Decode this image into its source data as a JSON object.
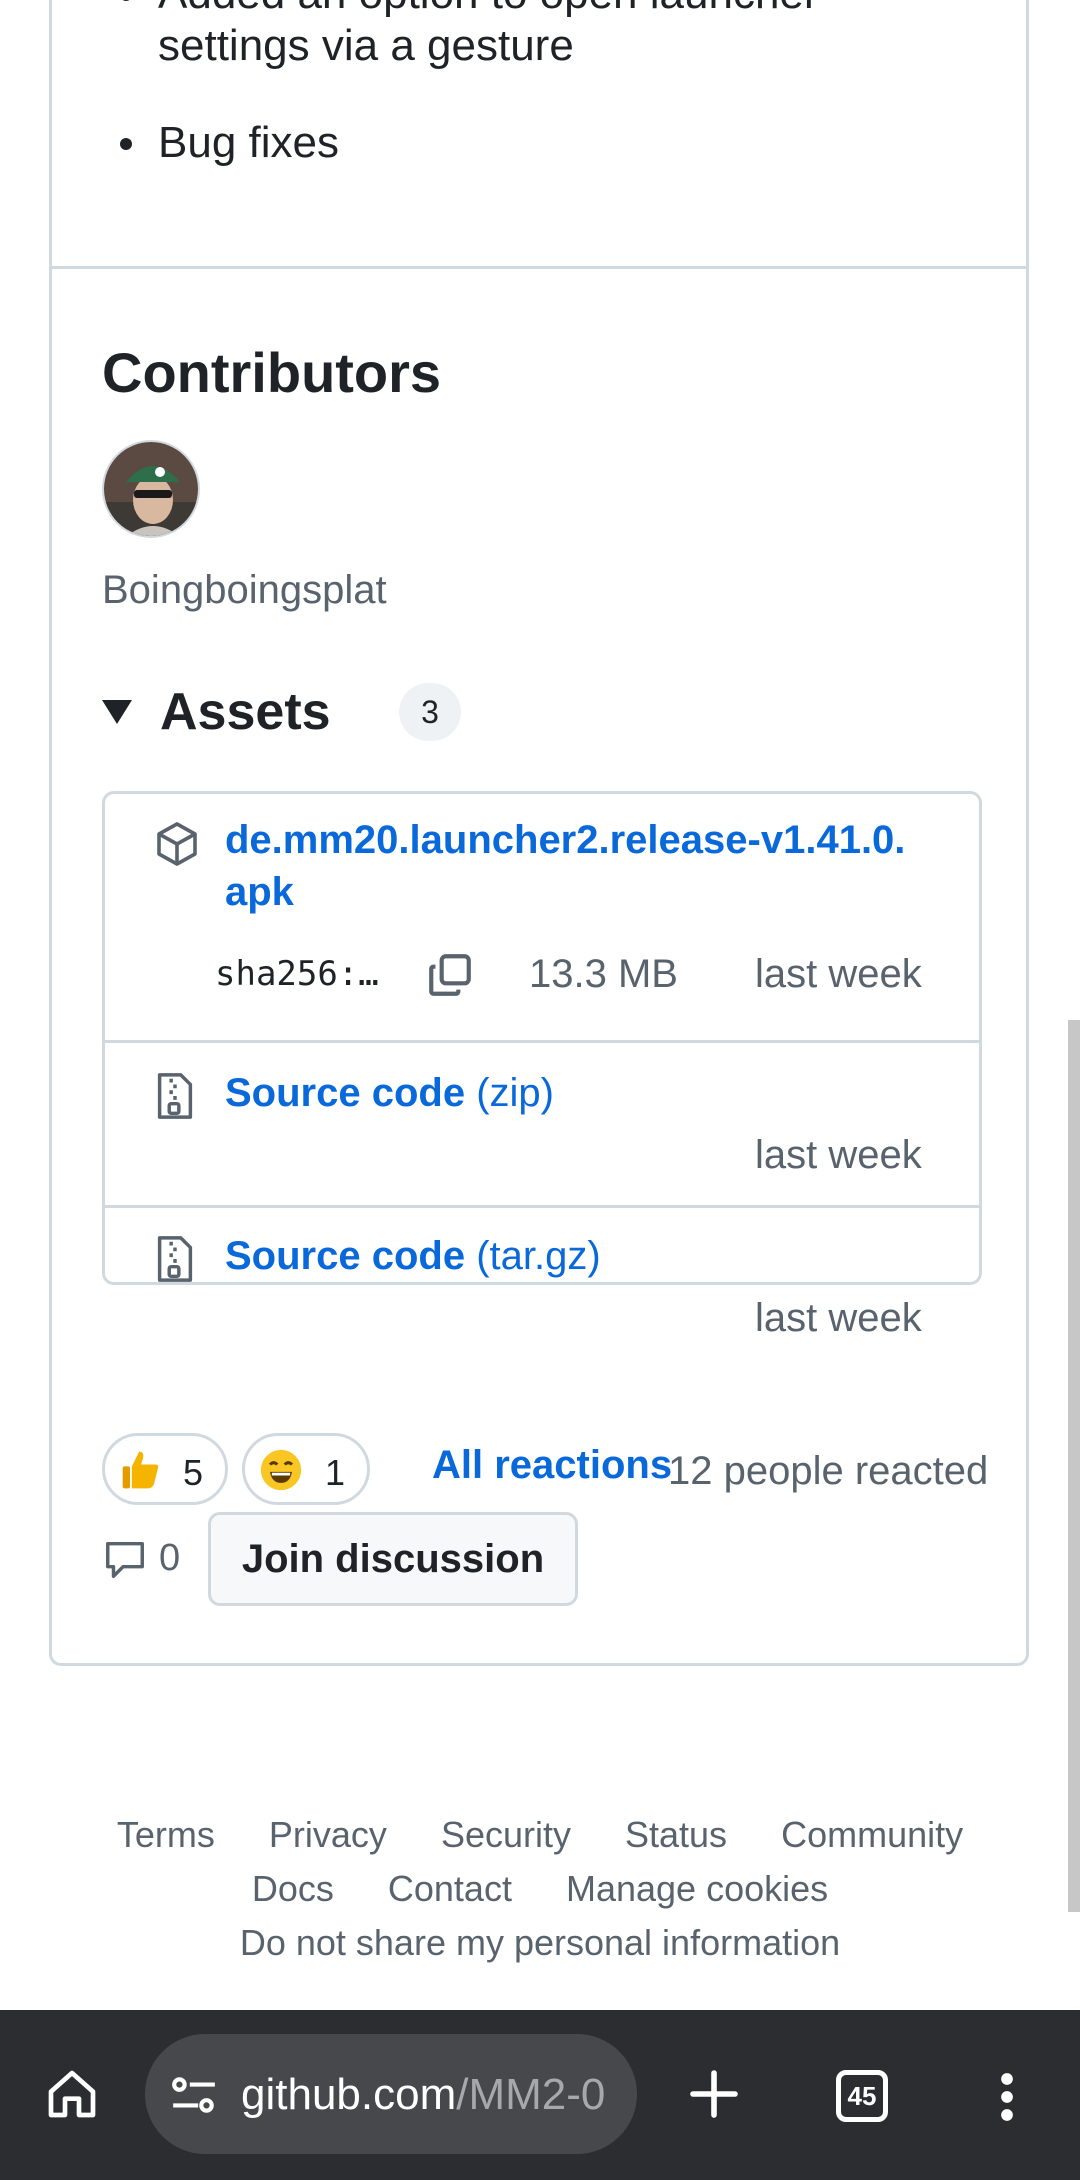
{
  "release_notes": {
    "items": [
      "Added an option to open launcher settings via a gesture",
      "Bug fixes"
    ],
    "item_line1": "Added an option to open launcher",
    "item_line2": "settings via a gesture",
    "item_2": "Bug fixes"
  },
  "contributors": {
    "title": "Contributors",
    "name": "Boingboingsplat"
  },
  "assets": {
    "title": "Assets",
    "count": "3",
    "items": [
      {
        "name_line1": "de.mm20.launcher2.release-v1.41.0.",
        "name_line2": "apk",
        "sha": "sha256:…",
        "size": "13.3 MB",
        "date": "last week"
      },
      {
        "name": "Source code",
        "ext": "(zip)",
        "date": "last week"
      },
      {
        "name": "Source code",
        "ext": "(tar.gz)",
        "date": "last week"
      }
    ]
  },
  "reactions": {
    "thumbs_up_count": "5",
    "smile_count": "1",
    "all_reactions": "All reactions",
    "people_reacted": "12 people reacted"
  },
  "discussion": {
    "comment_count": "0",
    "join_label": "Join discussion"
  },
  "footer": {
    "line1": [
      "Terms",
      "Privacy",
      "Security",
      "Status",
      "Community"
    ],
    "line2": [
      "Docs",
      "Contact",
      "Manage cookies"
    ],
    "line3": "Do not share my personal information"
  },
  "browser": {
    "url_host": "github.com",
    "url_path": "/MM2-0",
    "tab_count": "45"
  },
  "colors": {
    "link": "#0969da",
    "border": "#d1d9e0",
    "muted": "#59636e",
    "browser_bar": "#2b2d30"
  }
}
